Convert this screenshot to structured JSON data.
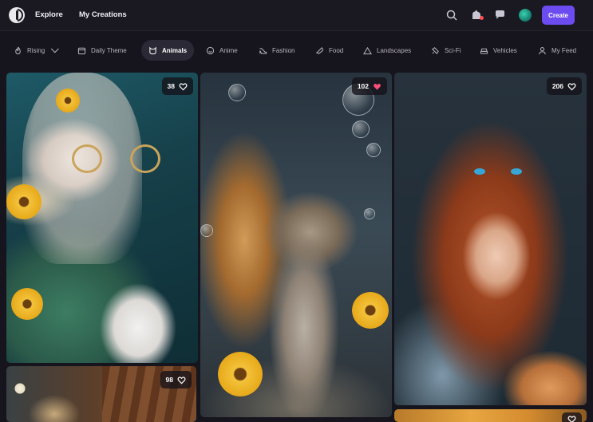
{
  "header": {
    "nav": [
      {
        "label": "Explore"
      },
      {
        "label": "My Creations"
      }
    ],
    "create_label": "Create"
  },
  "filters": [
    {
      "label": "Rising",
      "icon": "fire-icon"
    },
    {
      "label": "Daily Theme",
      "icon": "calendar-icon"
    },
    {
      "label": "Animals",
      "icon": "cat-icon"
    },
    {
      "label": "Anime",
      "icon": "smile-icon"
    },
    {
      "label": "Fashion",
      "icon": "heel-icon"
    },
    {
      "label": "Food",
      "icon": "food-icon"
    },
    {
      "label": "Landscapes",
      "icon": "mountain-icon"
    },
    {
      "label": "Sci-Fi",
      "icon": "ufo-icon"
    },
    {
      "label": "Vehicles",
      "icon": "car-icon"
    },
    {
      "label": "My Feed",
      "icon": "user-icon"
    }
  ],
  "active_filter": "Animals",
  "cards": [
    {
      "likes": "38",
      "liked": false,
      "subject": "Girl with glasses holding white cat"
    },
    {
      "likes": "102",
      "liked": true,
      "subject": "Squirrel with bubbles"
    },
    {
      "likes": "206",
      "liked": false,
      "subject": "Red-haired girl with tabby cat"
    },
    {
      "likes": "98",
      "liked": false,
      "subject": "Room with teapot and moon"
    },
    {
      "likes": "",
      "liked": false,
      "subject": "Autumn scene"
    }
  ],
  "colors": {
    "accent": "#6c4cf0",
    "liked_heart": "#ff4d7a",
    "background": "#16141c"
  }
}
